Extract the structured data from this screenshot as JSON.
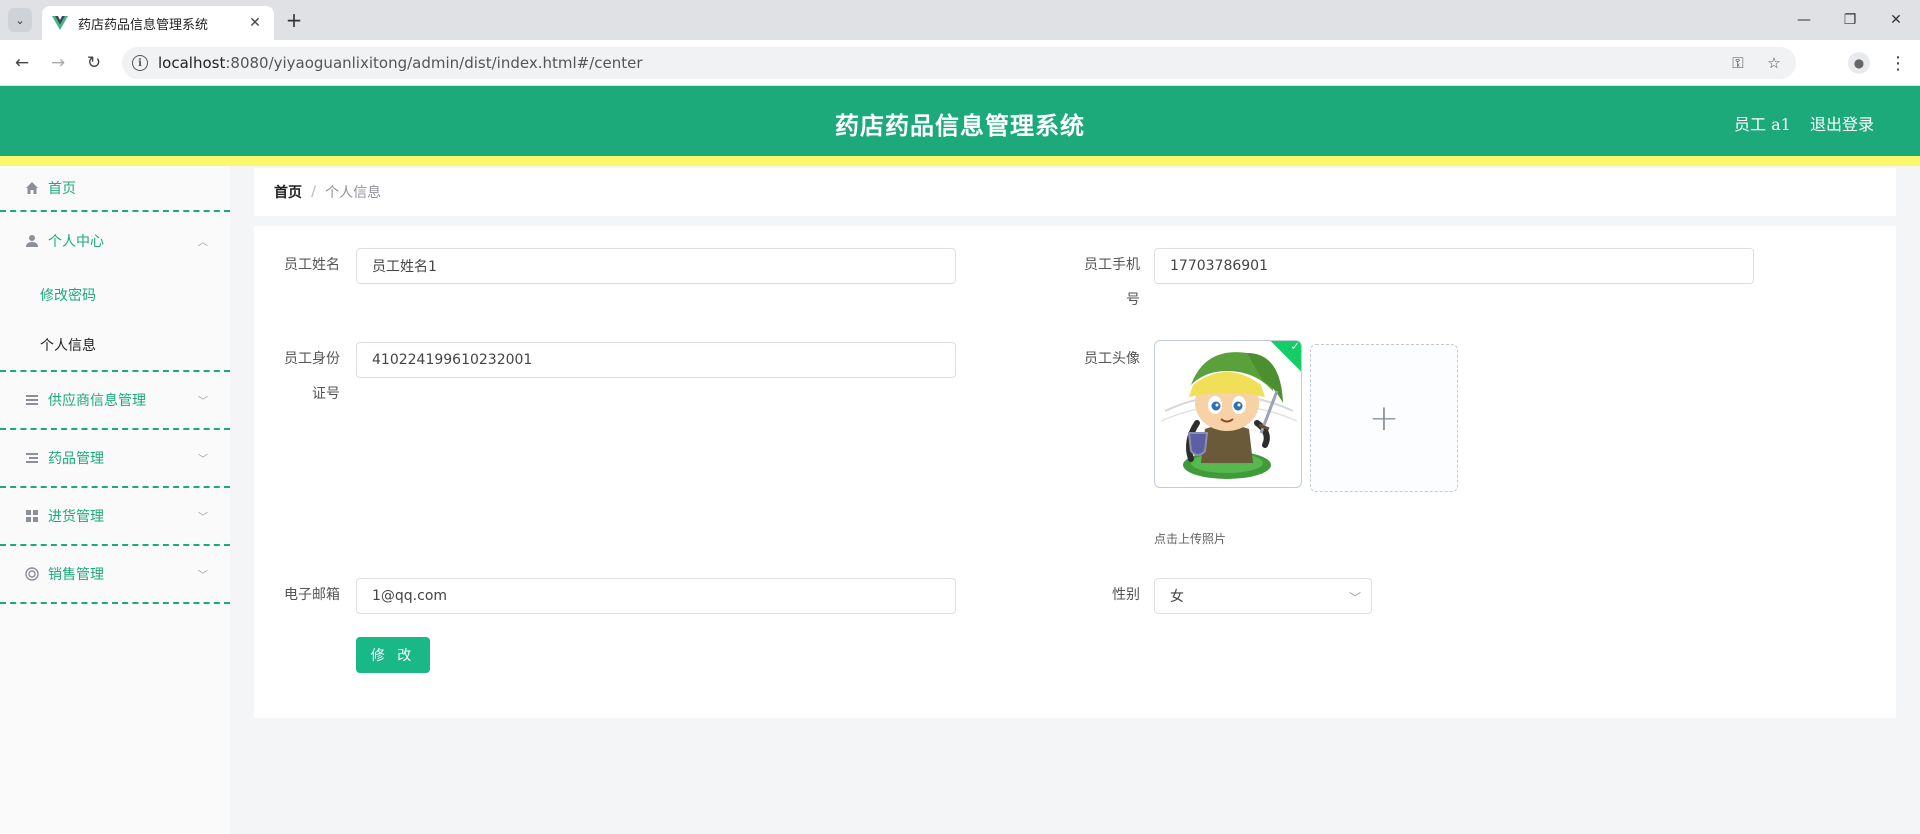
{
  "browser": {
    "tab_title": "药店药品信息管理系统",
    "url_host": "localhost",
    "url_rest": ":8080/yiyaoguanlixitong/admin/dist/index.html#/center"
  },
  "header": {
    "title": "药店药品信息管理系统",
    "user": "员工 a1",
    "logout": "退出登录",
    "accent_color": "#1caa7b",
    "stripe_color": "#faf96b"
  },
  "sidebar": {
    "home": "首页",
    "personal_center": "个人中心",
    "change_password": "修改密码",
    "personal_info": "个人信息",
    "supplier": "供应商信息管理",
    "drug": "药品管理",
    "purchase": "进货管理",
    "sales": "销售管理"
  },
  "breadcrumb": {
    "home": "首页",
    "separator": "/",
    "current": "个人信息"
  },
  "form": {
    "name_label": "员工姓名",
    "name_value": "员工姓名1",
    "phone_label_1": "员工手机",
    "phone_label_2": "号",
    "phone_value": "17703786901",
    "idcard_label_1": "员工身份",
    "idcard_label_2": "证号",
    "idcard_value": "410224199610232001",
    "avatar_label": "员工头像",
    "upload_tip": "点击上传照片",
    "email_label": "电子邮箱",
    "email_value": "1@qq.com",
    "gender_label": "性别",
    "gender_value": "女",
    "submit": "修 改"
  }
}
